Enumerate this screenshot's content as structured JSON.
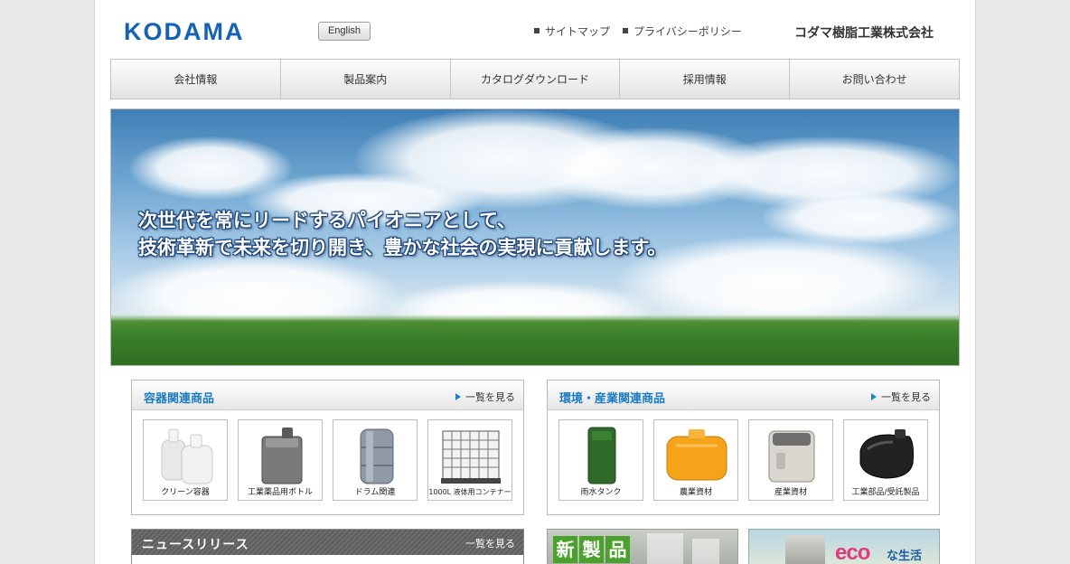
{
  "header": {
    "logo": "KODAMA",
    "english_label": "English",
    "util_links": [
      "サイトマップ",
      "プライバシーポリシー"
    ],
    "company": "コダマ樹脂工業株式会社"
  },
  "nav": {
    "items": [
      "会社情報",
      "製品案内",
      "カタログダウンロード",
      "採用情報",
      "お問い合わせ"
    ]
  },
  "hero": {
    "line1": "次世代を常にリードするパイオニアとして、",
    "line2": "技術革新で未来を切り開き、豊かな社会の実現に貢献します。"
  },
  "containers": {
    "title": "容器関連商品",
    "more": "一覧を見る",
    "items": [
      "クリーン容器",
      "工業薬品用ボトル",
      "ドラム関連",
      "1000L 液体用コンテナー"
    ]
  },
  "environment": {
    "title": "環境・産業関連商品",
    "more": "一覧を見る",
    "items": [
      "雨水タンク",
      "農業資材",
      "産業資材",
      "工業部品/受託製品"
    ]
  },
  "news": {
    "title": "ニュースリリース",
    "more": "一覧を見る"
  },
  "banners": {
    "new_product": [
      "新",
      "製",
      "品"
    ],
    "eco_prefix": "eco",
    "eco_suffix": "な生活"
  },
  "colors": {
    "accent_blue": "#1a7cc0",
    "logo_blue": "#1463b0",
    "news_header": "#656565",
    "new_green": "#4aa22c"
  }
}
